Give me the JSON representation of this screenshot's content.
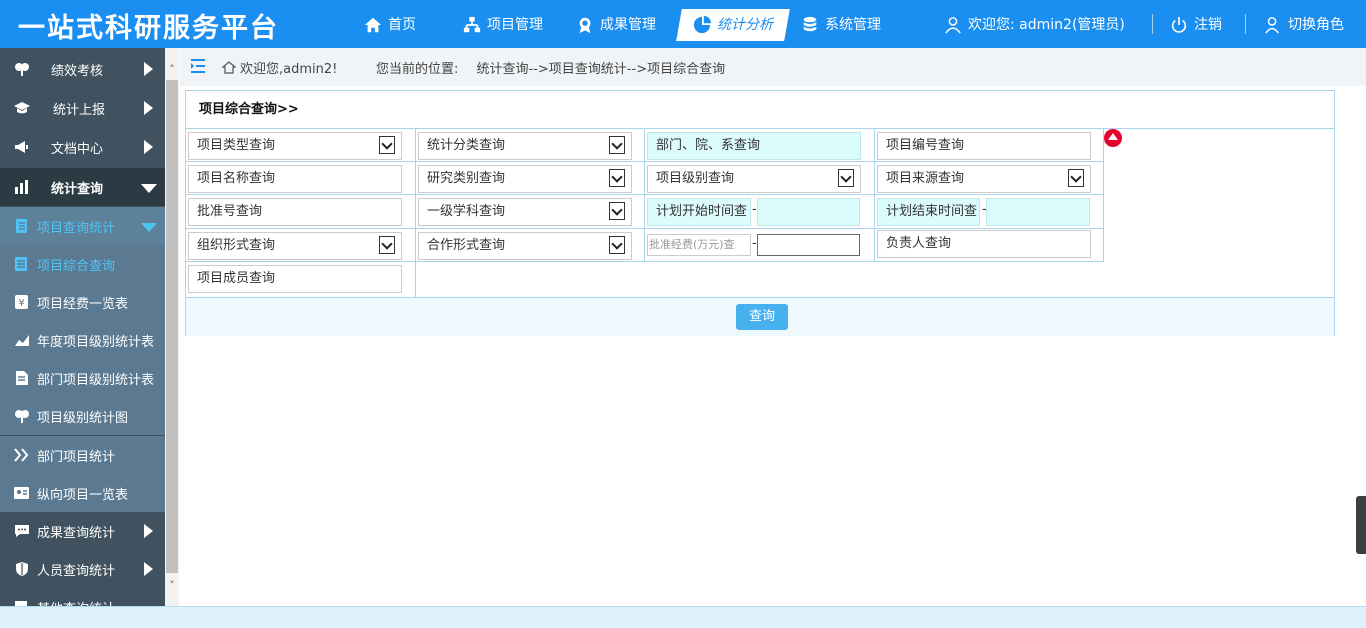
{
  "app": {
    "title": "一站式科研服务平台"
  },
  "nav": {
    "items": [
      {
        "label": "首页",
        "icon": "home-icon"
      },
      {
        "label": "项目管理",
        "icon": "sitemap-icon"
      },
      {
        "label": "成果管理",
        "icon": "award-icon"
      },
      {
        "label": "统计分析",
        "icon": "pie-chart-icon",
        "active": true
      },
      {
        "label": "系统管理",
        "icon": "database-icon"
      }
    ],
    "user": "欢迎您:  admin2(管理员)",
    "logout": "注销",
    "switch_role": "切换角色"
  },
  "sidebar": {
    "items": [
      {
        "label": "绩效考核",
        "icon": "tree-icon"
      },
      {
        "label": "统计上报",
        "icon": "graduation-cap-icon"
      },
      {
        "label": "文档中心",
        "icon": "megaphone-icon"
      },
      {
        "label": "统计查询",
        "icon": "bar-chart-icon",
        "expanded": true
      },
      {
        "label": "项目查询统计",
        "icon": "book-icon",
        "expanded": true
      },
      {
        "label": "项目综合查询",
        "icon": "list-icon",
        "selected": true
      },
      {
        "label": "项目经费一览表",
        "icon": "money-icon"
      },
      {
        "label": "年度项目级别统计表",
        "icon": "area-chart-icon"
      },
      {
        "label": "部门项目级别统计表",
        "icon": "file-icon"
      },
      {
        "label": "项目级别统计图",
        "icon": "tree-icon"
      },
      {
        "label": "部门项目统计",
        "icon": "double-chevron-icon"
      },
      {
        "label": "纵向项目一览表",
        "icon": "id-card-icon"
      },
      {
        "label": "成果查询统计",
        "icon": "comment-icon"
      },
      {
        "label": "人员查询统计",
        "icon": "shield-icon"
      },
      {
        "label": "其他查询统计",
        "icon": "misc-icon"
      }
    ]
  },
  "breadcrumb": {
    "welcome": "欢迎您,admin2!",
    "location_label": "您当前的位置:",
    "path": "统计查询-->项目查询统计-->项目综合查询"
  },
  "panel": {
    "title": "项目综合查询>>",
    "fields": {
      "project_type": "项目类型查询",
      "stat_category": "统计分类查询",
      "department": "部门、院、系查询",
      "project_no": "项目编号查询",
      "project_name": "项目名称查询",
      "research_type": "研究类别查询",
      "project_level": "项目级别查询",
      "project_source": "项目来源查询",
      "approval_no": "批准号查询",
      "discipline": "一级学科查询",
      "plan_start": "计划开始时间查",
      "plan_end": "计划结束时间查",
      "org_form": "组织形式查询",
      "coop_form": "合作形式查询",
      "funding": "批准经费(万元)查",
      "leader": "负责人查询",
      "member": "项目成员查询"
    },
    "dash": "-",
    "query_button": "查询"
  },
  "colors": {
    "header": "#1b8ff1",
    "sidebar": "#40525f",
    "accent": "#4fc3f7",
    "border": "#a9d6ee"
  }
}
